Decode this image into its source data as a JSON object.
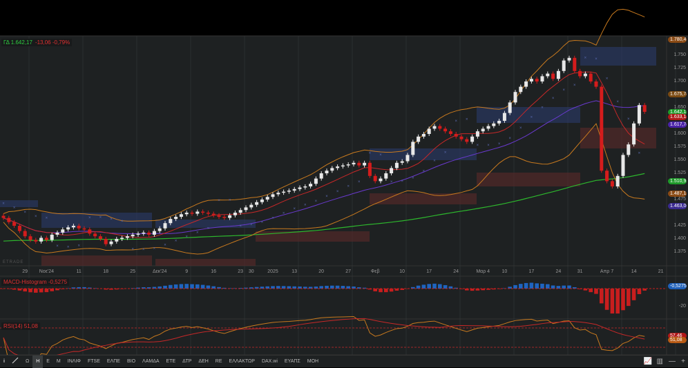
{
  "quote": {
    "symbol_value": "ΓΔ 1.642,17",
    "change": "-13,06 -0,79%"
  },
  "watermark": "ETRADE",
  "price_axis": [
    "1.750",
    "1.725",
    "1.700",
    "1.650",
    "1.600",
    "1.575",
    "1.550",
    "1.525",
    "1.475",
    "1.425",
    "1.400",
    "1.375"
  ],
  "price_axis_values": [
    1750,
    1725,
    1700,
    1650,
    1600,
    1575,
    1550,
    1525,
    1475,
    1425,
    1400,
    1375
  ],
  "price_tags": [
    {
      "label": "1.780,4",
      "value": 1780.4,
      "color": "#8a4a14"
    },
    {
      "label": "1.675,78",
      "value": 1675.78,
      "color": "#7a4a12"
    },
    {
      "label": "1.642,17",
      "value": 1642.17,
      "color": "#1e9a2a"
    },
    {
      "label": "1.633,19",
      "value": 1633.19,
      "color": "#b01818"
    },
    {
      "label": "1.617,78",
      "value": 1617.78,
      "color": "#4a22a8"
    },
    {
      "label": "1.510,91",
      "value": 1510.91,
      "color": "#1e9a2a"
    },
    {
      "label": "1.487,1",
      "value": 1487.1,
      "color": "#8a4a14"
    },
    {
      "label": "1.463,06",
      "value": 1463.06,
      "color": "#3a2a90"
    }
  ],
  "date_axis": [
    {
      "label": "29",
      "i": 4
    },
    {
      "label": "Νοε'24",
      "i": 8
    },
    {
      "label": "11",
      "i": 14
    },
    {
      "label": "18",
      "i": 19
    },
    {
      "label": "25",
      "i": 24
    },
    {
      "label": "Δεκ'24",
      "i": 29
    },
    {
      "label": "9",
      "i": 34
    },
    {
      "label": "16",
      "i": 39
    },
    {
      "label": "23",
      "i": 44
    },
    {
      "label": "30",
      "i": 46
    },
    {
      "label": "2025",
      "i": 50
    },
    {
      "label": "13",
      "i": 54
    },
    {
      "label": "20",
      "i": 59
    },
    {
      "label": "27",
      "i": 64
    },
    {
      "label": "Φεβ",
      "i": 69
    },
    {
      "label": "10",
      "i": 74
    },
    {
      "label": "17",
      "i": 79
    },
    {
      "label": "24",
      "i": 84
    },
    {
      "label": "Μαρ 4",
      "i": 89
    },
    {
      "label": "10",
      "i": 93
    },
    {
      "label": "17",
      "i": 98
    },
    {
      "label": "24",
      "i": 103
    },
    {
      "label": "31",
      "i": 107
    },
    {
      "label": "Απρ 7",
      "i": 112
    },
    {
      "label": "14",
      "i": 117
    },
    {
      "label": "21",
      "i": 122
    }
  ],
  "macd": {
    "label": "MACD-Histogram -0,5275",
    "tag": "-0,5275",
    "axis": "-20"
  },
  "rsi": {
    "label": "RSI(14) 51,08",
    "tag1": "57,46",
    "tag2": "51,08"
  },
  "chart_data": {
    "type": "candlestick",
    "closes": [
      1440,
      1432,
      1425,
      1415,
      1405,
      1398,
      1395,
      1402,
      1398,
      1408,
      1412,
      1418,
      1422,
      1425,
      1420,
      1418,
      1410,
      1405,
      1400,
      1390,
      1395,
      1400,
      1402,
      1405,
      1408,
      1410,
      1412,
      1408,
      1415,
      1420,
      1430,
      1438,
      1442,
      1447,
      1450,
      1448,
      1452,
      1450,
      1448,
      1445,
      1442,
      1440,
      1445,
      1450,
      1455,
      1460,
      1465,
      1470,
      1475,
      1480,
      1485,
      1488,
      1490,
      1492,
      1495,
      1498,
      1500,
      1505,
      1515,
      1525,
      1530,
      1535,
      1538,
      1540,
      1542,
      1545,
      1540,
      1545,
      1520,
      1510,
      1515,
      1525,
      1535,
      1545,
      1548,
      1560,
      1585,
      1595,
      1600,
      1610,
      1615,
      1610,
      1605,
      1600,
      1595,
      1590,
      1585,
      1595,
      1605,
      1610,
      1615,
      1620,
      1625,
      1640,
      1660,
      1680,
      1690,
      1700,
      1705,
      1700,
      1710,
      1715,
      1705,
      1720,
      1740,
      1745,
      1720,
      1710,
      1715,
      1700,
      1690,
      1530,
      1510,
      1500,
      1520,
      1560,
      1580,
      1620,
      1655,
      1642.17
    ],
    "ylim": [
      1350,
      1790
    ]
  },
  "toolbar": {
    "items": [
      "Ω",
      "Η",
      "Ε",
      "Μ",
      "ΙΝΛΙΦ",
      "FTSE",
      "ΕΛΠΕ",
      "ΒΙΟ",
      "ΛΑΜΔΑ",
      "ΕΤΕ",
      "ΔΤΡ",
      "ΔΕΗ",
      "RE",
      "ΕΛΛΑΚΤΩΡ",
      "DAX.wi",
      "ΕΥΑΠΣ",
      "ΜΟΗ"
    ],
    "active": 1,
    "minus": "—",
    "plus": "+"
  }
}
